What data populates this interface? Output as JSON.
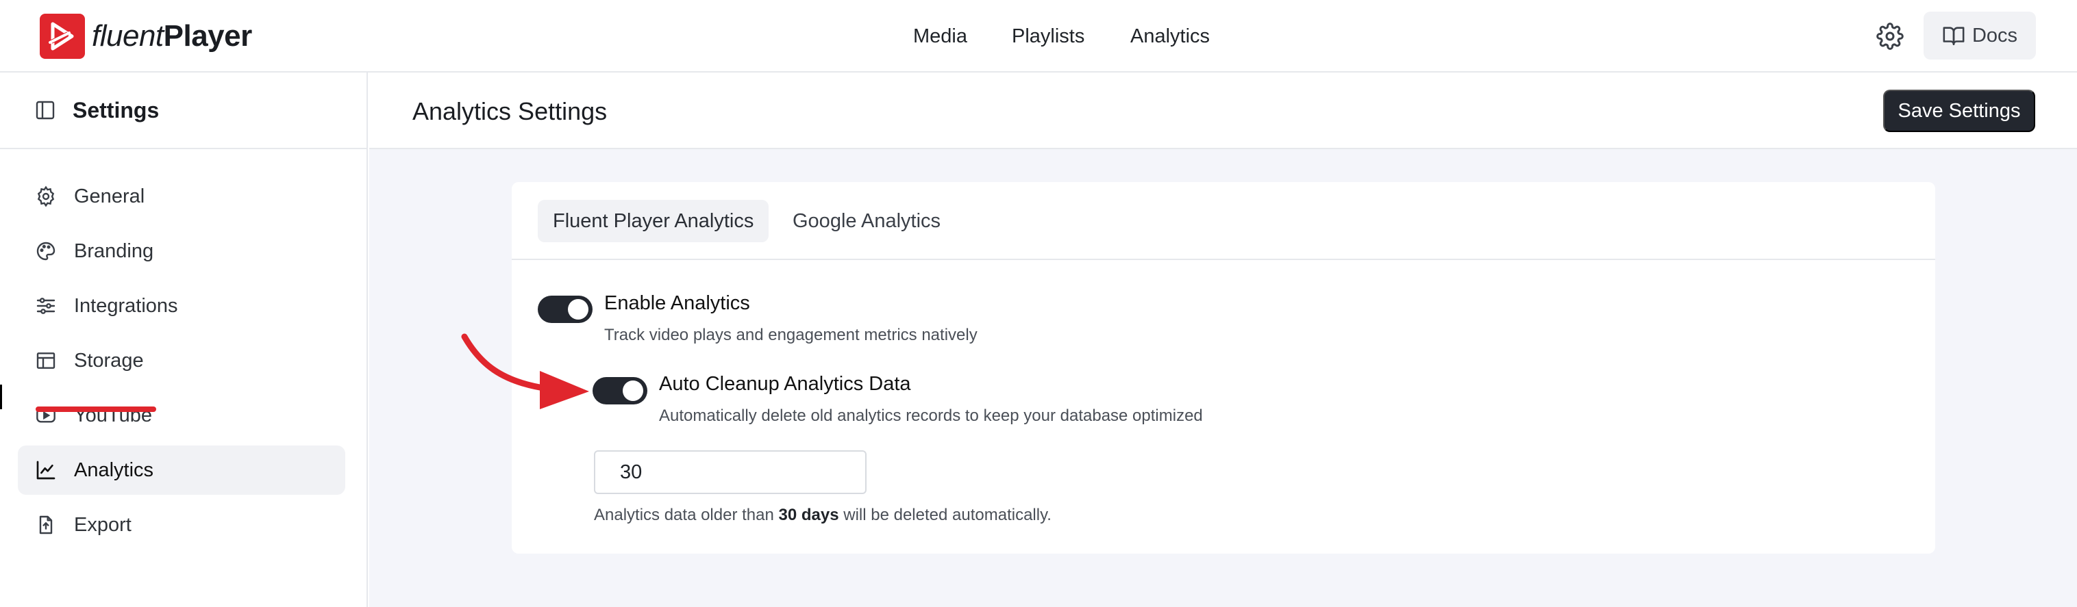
{
  "brand": {
    "name_light": "fluent",
    "name_bold": "Player",
    "color": "#e0262d"
  },
  "topnav": {
    "items": [
      "Media",
      "Playlists",
      "Analytics"
    ],
    "docs_label": "Docs"
  },
  "sidebar": {
    "title": "Settings",
    "items": [
      {
        "label": "General",
        "icon": "gear-icon"
      },
      {
        "label": "Branding",
        "icon": "palette-icon"
      },
      {
        "label": "Integrations",
        "icon": "sliders-icon"
      },
      {
        "label": "Storage",
        "icon": "storage-icon"
      },
      {
        "label": "YouTube",
        "icon": "youtube-icon"
      },
      {
        "label": "Analytics",
        "icon": "chart-line-icon",
        "active": true
      },
      {
        "label": "Export",
        "icon": "export-icon"
      }
    ]
  },
  "main": {
    "title": "Analytics Settings",
    "save_label": "Save Settings",
    "tabs": [
      {
        "label": "Fluent Player Analytics",
        "active": true
      },
      {
        "label": "Google Analytics",
        "active": false
      }
    ],
    "enable_analytics": {
      "title": "Enable Analytics",
      "desc": "Track video plays and engagement metrics natively",
      "on": true
    },
    "auto_cleanup": {
      "title": "Auto Cleanup Analytics Data",
      "desc": "Automatically delete old analytics records to keep your database optimized",
      "on": true
    },
    "cleanup_days": {
      "value": "30",
      "help_prefix": "Analytics data older than",
      "help_bold": "30 days",
      "help_suffix": "will be deleted automatically."
    }
  },
  "colors": {
    "accent": "#e0262d",
    "dark": "#23272f",
    "canvas": "#f4f5fa"
  }
}
